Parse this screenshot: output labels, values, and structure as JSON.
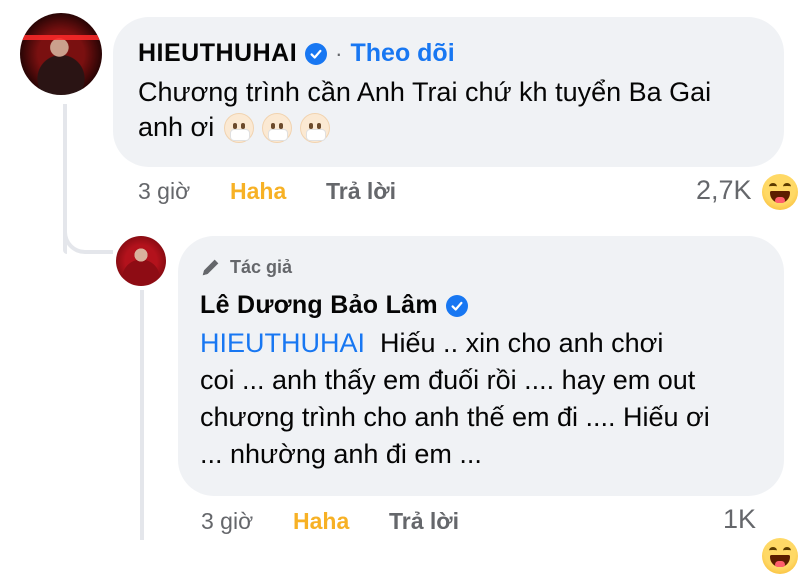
{
  "comment": {
    "author": "HIEUTHUHAI",
    "follow_label": "Theo dõi",
    "separator": "·",
    "text_line1": "Chương trình cần Anh Trai chứ kh tuyển Ba Gai",
    "text_line2": "anh ơi",
    "emojis": [
      "mask-face-emoji",
      "mask-face-emoji",
      "mask-face-emoji"
    ],
    "time": "3 giờ",
    "reaction_label": "Haha",
    "reply_label": "Trả lời",
    "reaction_count": "2,7K",
    "reaction_icon": "haha-icon"
  },
  "reply": {
    "badge_label": "Tác giả",
    "author": "Lê Dương Bảo Lâm",
    "mention": "HIEUTHUHAI",
    "line1": "Hiếu .. xin cho anh chơi",
    "line2": "coi ... anh thấy em đuối rồi .... hay em out",
    "line3": "chương trình cho anh thế em đi .... Hiếu ơi",
    "line4": "... nhường anh đi em ...",
    "time": "3 giờ",
    "reaction_label": "Haha",
    "reply_label": "Trả lời",
    "reaction_count": "1K",
    "reaction_icon": "haha-icon"
  },
  "colors": {
    "bubble": "#f0f2f5",
    "link": "#1877f2",
    "haha": "#f7b125",
    "muted": "#65676b"
  }
}
